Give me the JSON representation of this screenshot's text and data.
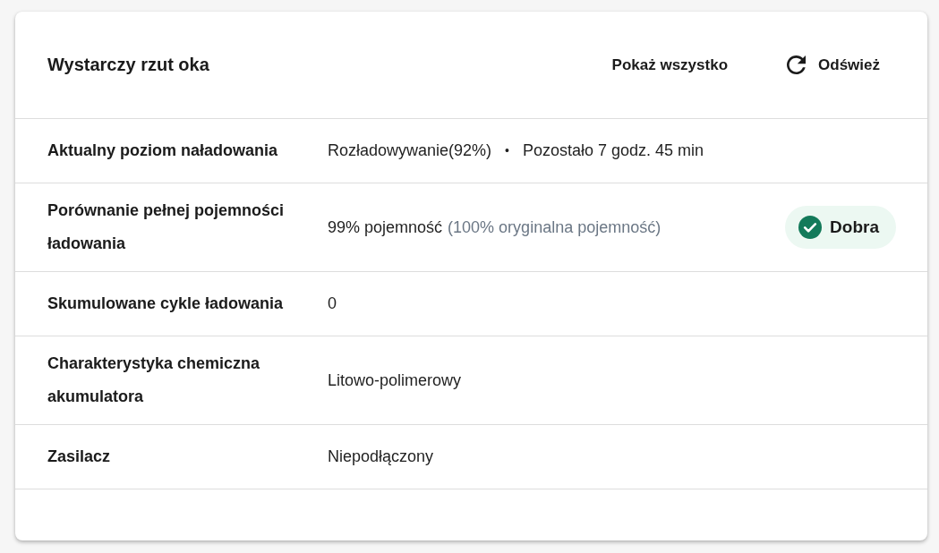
{
  "panel": {
    "title": "Wystarczy rzut oka",
    "actions": [
      {
        "kind": "link",
        "label": "Pokaż wszystko"
      },
      {
        "kind": "refresh",
        "label": "Odśwież"
      }
    ]
  },
  "rows": [
    {
      "label": "Aktualny poziom naładowania",
      "parts": [
        {
          "kind": "main",
          "text": "Rozładowywanie(92%)"
        },
        {
          "kind": "separator",
          "text": "•"
        },
        {
          "kind": "main",
          "text": "Pozostało 7 godz. 45 min"
        }
      ]
    },
    {
      "label": "Porównanie pełnej pojemności ładowania",
      "parts": [
        {
          "kind": "main",
          "text": "99% pojemność"
        },
        {
          "kind": "muted",
          "text": "(100% oryginalna pojemność)"
        }
      ],
      "status": {
        "kind": "good",
        "label": "Dobra"
      }
    },
    {
      "label": "Skumulowane cykle ładowania",
      "parts": [
        {
          "kind": "main",
          "text": "0"
        }
      ]
    },
    {
      "label": "Charakterystyka chemiczna akumulatora",
      "parts": [
        {
          "kind": "main",
          "text": "Litowo-polimerowy"
        }
      ]
    },
    {
      "label": "Zasilacz",
      "parts": [
        {
          "kind": "main",
          "text": "Niepodłączony"
        }
      ]
    }
  ]
}
